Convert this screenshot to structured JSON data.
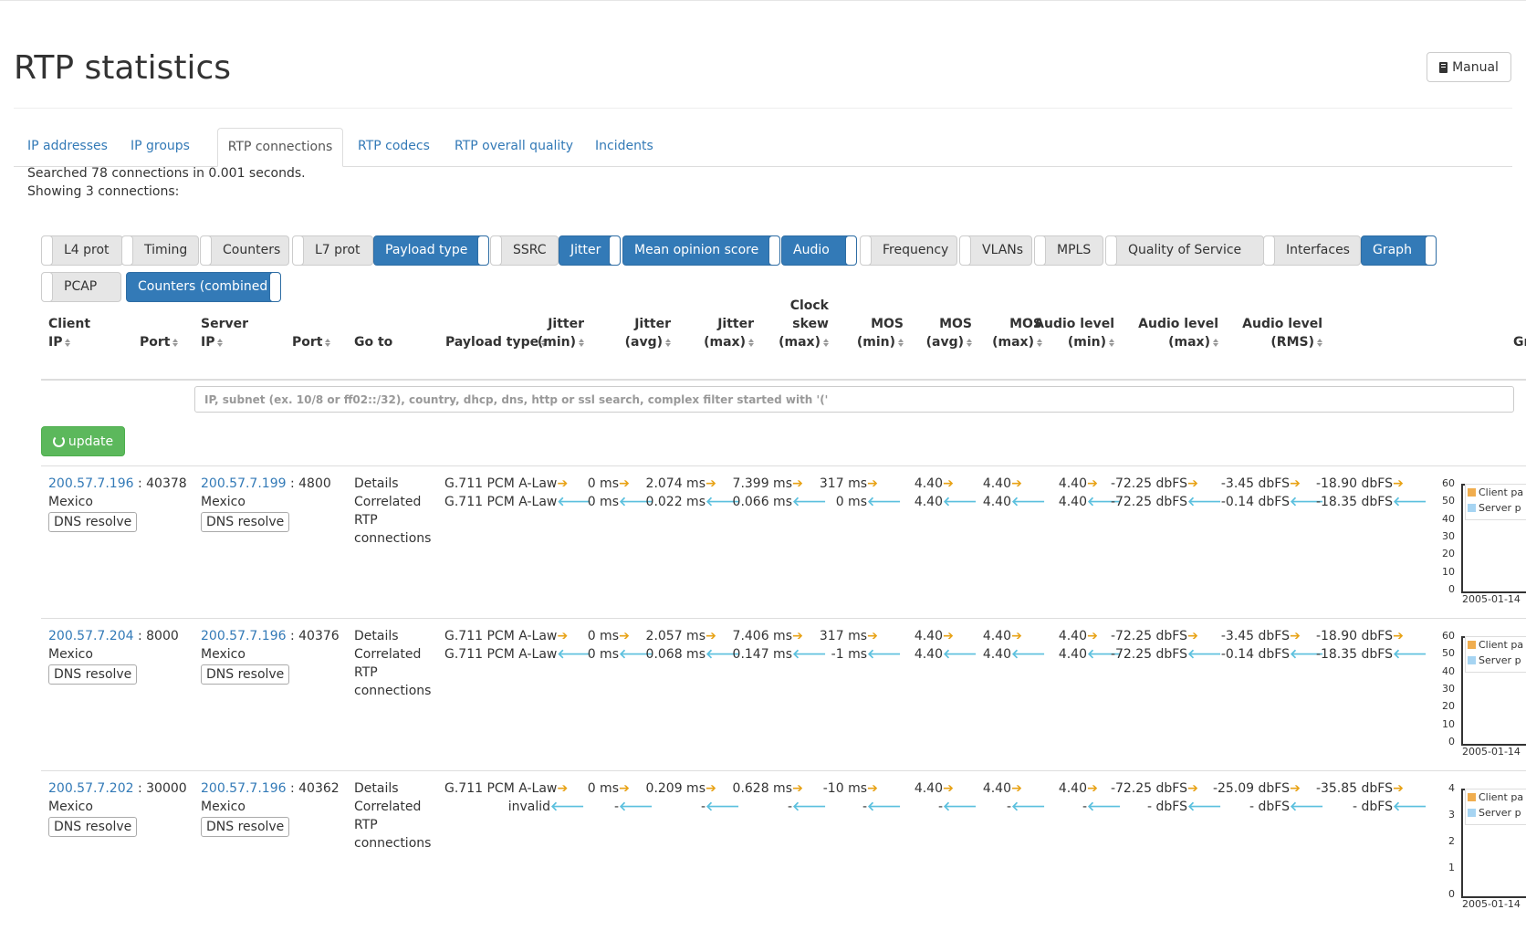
{
  "page": {
    "title": "RTP statistics",
    "manual_label": "Manual"
  },
  "tabs": [
    {
      "label": "IP addresses",
      "active": false
    },
    {
      "label": "IP groups",
      "active": false
    },
    {
      "label": "RTP connections",
      "active": true
    },
    {
      "label": "RTP codecs",
      "active": false
    },
    {
      "label": "RTP overall quality",
      "active": false
    },
    {
      "label": "Incidents",
      "active": false
    }
  ],
  "info": {
    "searched": "Searched 78 connections in 0.001 seconds.",
    "showing": "Showing 3 connections:"
  },
  "column_toggles": [
    {
      "label": "L4 prot",
      "on": false
    },
    {
      "label": "Timing",
      "on": false
    },
    {
      "label": "Counters",
      "on": false
    },
    {
      "label": "L7 prot",
      "on": false
    },
    {
      "label": "Payload type",
      "on": true
    },
    {
      "label": "SSRC",
      "on": false
    },
    {
      "label": "Jitter",
      "on": true
    },
    {
      "label": "Mean opinion score",
      "on": true
    },
    {
      "label": "Audio",
      "on": true
    },
    {
      "label": "Frequency",
      "on": false
    },
    {
      "label": "VLANs",
      "on": false
    },
    {
      "label": "MPLS",
      "on": false
    },
    {
      "label": "Quality of Service",
      "on": false
    },
    {
      "label": "Interfaces",
      "on": false
    },
    {
      "label": "Graph",
      "on": true
    },
    {
      "label": "PCAP",
      "on": false
    },
    {
      "label": "Counters (combined",
      "on": true
    }
  ],
  "columns": {
    "client_ip": [
      "Client",
      "IP"
    ],
    "client_port": [
      "Port"
    ],
    "server_ip": [
      "Server",
      "IP"
    ],
    "server_port": [
      "Port"
    ],
    "goto": [
      "Go to"
    ],
    "payload": [
      "Payload type"
    ],
    "jitter_min": [
      "Jitter",
      "(min)"
    ],
    "jitter_avg": [
      "Jitter",
      "(avg)"
    ],
    "jitter_max": [
      "Jitter",
      "(max)"
    ],
    "clock_skew": [
      "Clock",
      "skew",
      "(max)"
    ],
    "mos_min": [
      "MOS",
      "(min)"
    ],
    "mos_avg": [
      "MOS",
      "(avg)"
    ],
    "mos_max": [
      "MOS",
      "(max)"
    ],
    "audio_min": [
      "Audio level",
      "(min)"
    ],
    "audio_max": [
      "Audio level",
      "(max)"
    ],
    "audio_rms": [
      "Audio level",
      "(RMS)"
    ],
    "graph": [
      "Gr"
    ]
  },
  "filter": {
    "placeholder": "IP, subnet (ex. 10/8 or ff02::/32), country, dhcp, dns, http or ssl search, complex filter started with '('"
  },
  "update_label": "update",
  "dns_label": "DNS resolve",
  "goto_links": {
    "details": "Details",
    "correlated_1": "Correlated",
    "correlated_2": "RTP",
    "correlated_3": "connections"
  },
  "icons": {
    "out_arrow": "➔",
    "in_arrow": "🡐",
    "colors": {
      "out": "#e8a317",
      "in": "#5bc0de",
      "client_swatch": "#f0ad4e",
      "server_swatch": "#a6d4f2"
    }
  },
  "graph_legend": {
    "client": "Client pa",
    "server": "Server p"
  },
  "rows": [
    {
      "client_ip": "200.57.7.196",
      "client_port": ": 40378",
      "client_country": "Mexico",
      "server_ip": "200.57.7.199",
      "server_port": ": 4800",
      "server_country": "Mexico",
      "payload": [
        "G.711 PCM A-Law",
        "G.711 PCM A-Law"
      ],
      "jitter_min": [
        "0 ms",
        "0 ms"
      ],
      "jitter_avg": [
        "2.074 ms",
        "0.022 ms"
      ],
      "jitter_max": [
        "7.399 ms",
        "0.066 ms"
      ],
      "clock_skew": [
        "317 ms",
        "0 ms"
      ],
      "mos_min": [
        "4.40",
        "4.40"
      ],
      "mos_avg": [
        "4.40",
        "4.40"
      ],
      "mos_max": [
        "4.40",
        "4.40"
      ],
      "audio_min": [
        "-72.25 dbFS",
        "-72.25 dbFS"
      ],
      "audio_max": [
        "-3.45 dbFS",
        "-0.14 dbFS"
      ],
      "audio_rms": [
        "-18.90 dbFS",
        "-18.35 dbFS"
      ],
      "graph_ticks": [
        "60",
        "50",
        "40",
        "30",
        "20",
        "10",
        "0"
      ],
      "graph_date": "2005-01-14"
    },
    {
      "client_ip": "200.57.7.204",
      "client_port": ": 8000",
      "client_country": "Mexico",
      "server_ip": "200.57.7.196",
      "server_port": ": 40376",
      "server_country": "Mexico",
      "payload": [
        "G.711 PCM A-Law",
        "G.711 PCM A-Law"
      ],
      "jitter_min": [
        "0 ms",
        "0 ms"
      ],
      "jitter_avg": [
        "2.057 ms",
        "0.068 ms"
      ],
      "jitter_max": [
        "7.406 ms",
        "0.147 ms"
      ],
      "clock_skew": [
        "317 ms",
        "-1 ms"
      ],
      "mos_min": [
        "4.40",
        "4.40"
      ],
      "mos_avg": [
        "4.40",
        "4.40"
      ],
      "mos_max": [
        "4.40",
        "4.40"
      ],
      "audio_min": [
        "-72.25 dbFS",
        "-72.25 dbFS"
      ],
      "audio_max": [
        "-3.45 dbFS",
        "-0.14 dbFS"
      ],
      "audio_rms": [
        "-18.90 dbFS",
        "-18.35 dbFS"
      ],
      "graph_ticks": [
        "60",
        "50",
        "40",
        "30",
        "20",
        "10",
        "0"
      ],
      "graph_date": "2005-01-14"
    },
    {
      "client_ip": "200.57.7.202",
      "client_port": ": 30000",
      "client_country": "Mexico",
      "server_ip": "200.57.7.196",
      "server_port": ": 40362",
      "server_country": "Mexico",
      "payload": [
        "G.711 PCM A-Law",
        "invalid"
      ],
      "jitter_min": [
        "0 ms",
        "-"
      ],
      "jitter_avg": [
        "0.209 ms",
        "-"
      ],
      "jitter_max": [
        "0.628 ms",
        "-"
      ],
      "clock_skew": [
        "-10 ms",
        "-"
      ],
      "mos_min": [
        "4.40",
        "-"
      ],
      "mos_avg": [
        "4.40",
        "-"
      ],
      "mos_max": [
        "4.40",
        "-"
      ],
      "audio_min": [
        "-72.25 dbFS",
        "- dbFS"
      ],
      "audio_max": [
        "-25.09 dbFS",
        "- dbFS"
      ],
      "audio_rms": [
        "-35.85 dbFS",
        "- dbFS"
      ],
      "graph_ticks": [
        "4",
        "3",
        "2",
        "1",
        "0"
      ],
      "graph_date": "2005-01-14"
    }
  ]
}
